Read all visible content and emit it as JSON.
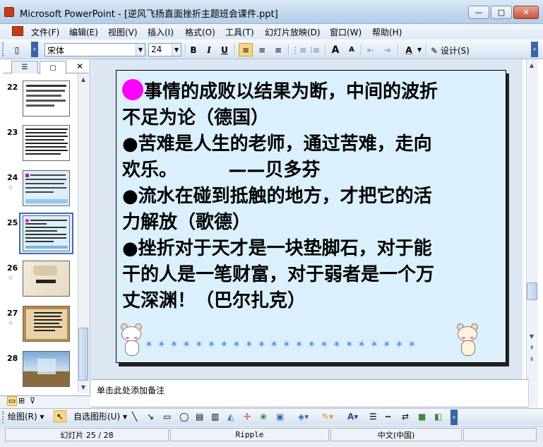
{
  "window": {
    "title": "Microsoft PowerPoint - [逆风飞扬直面挫折主题班会课件.ppt]",
    "buttons": {
      "minimize": "—",
      "maximize": "□",
      "close": "✕"
    }
  },
  "menu": {
    "items": [
      "文件(F)",
      "编辑(E)",
      "视图(V)",
      "插入(I)",
      "格式(O)",
      "工具(T)",
      "幻灯片放映(D)",
      "窗口(W)",
      "帮助(H)"
    ]
  },
  "toolbar": {
    "font_name": "宋体",
    "font_size": "24",
    "bold": "B",
    "italic": "I",
    "underline": "U",
    "grow": "A",
    "shrink": "A",
    "font_color": "A",
    "design": "设计(S)"
  },
  "thumbnails": [
    {
      "number": "22",
      "has_star": false
    },
    {
      "number": "23",
      "has_star": false
    },
    {
      "number": "24",
      "has_star": true
    },
    {
      "number": "25",
      "has_star": false,
      "selected": true
    },
    {
      "number": "26",
      "has_star": true
    },
    {
      "number": "27",
      "has_star": true
    },
    {
      "number": "28",
      "has_star": false
    }
  ],
  "thumb_star": "☆",
  "slide": {
    "paragraphs": [
      "事情的成败以结果为断，中间的波折",
      "不足为论（德国）",
      "●苦难是人生的老师，通过苦难，走向",
      "欢乐。        ——贝多芬",
      "●流水在碰到抵触的地方，才把它的活",
      "力解放（歌德）",
      "●挫折对于天才是一块垫脚石，对于能",
      "干的人是一笔财富，对于弱者是一个万",
      "丈深渊！（巴尔扎克）"
    ],
    "first_bullet_color": "#ff00ff",
    "background": "#dbf0fc"
  },
  "notes": {
    "placeholder": "单击此处添加备注"
  },
  "drawing_toolbar": {
    "draw": "绘图(R)",
    "autoshapes": "自选图形(U)"
  },
  "status": {
    "slide": "幻灯片 25 / 28",
    "design": "Ripple",
    "language": "中文(中国)"
  }
}
